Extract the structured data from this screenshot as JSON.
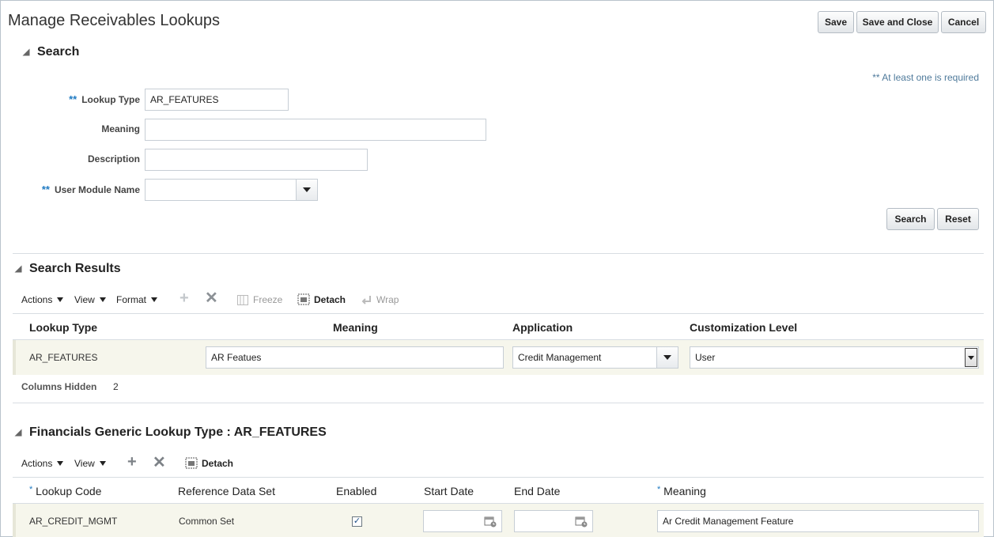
{
  "page": {
    "title": "Manage Receivables Lookups",
    "buttons": {
      "save": "Save",
      "save_and_close": "Save and Close",
      "cancel": "Cancel"
    }
  },
  "search": {
    "header": "Search",
    "required_note": "** At least one is required",
    "required_mark": "**",
    "fields": {
      "lookup_type": {
        "label": "Lookup Type",
        "value": "AR_FEATURES"
      },
      "meaning": {
        "label": "Meaning",
        "value": ""
      },
      "description": {
        "label": "Description",
        "value": ""
      },
      "user_module_name": {
        "label": "User Module Name",
        "value": ""
      }
    },
    "buttons": {
      "search": "Search",
      "reset": "Reset"
    }
  },
  "results": {
    "header": "Search Results",
    "toolbar": {
      "actions": "Actions",
      "view": "View",
      "format": "Format",
      "freeze": "Freeze",
      "detach": "Detach",
      "wrap": "Wrap"
    },
    "columns": [
      "Lookup Type",
      "Meaning",
      "Application",
      "Customization Level"
    ],
    "rows": [
      {
        "lookup_type": "AR_FEATURES",
        "meaning": "AR Featues",
        "application": "Credit Management",
        "customization_level": "User"
      }
    ],
    "columns_hidden_label": "Columns Hidden",
    "columns_hidden_count": "2"
  },
  "detail": {
    "header": "Financials Generic Lookup Type : AR_FEATURES",
    "toolbar": {
      "actions": "Actions",
      "view": "View",
      "detach": "Detach"
    },
    "required_mark": "*",
    "columns": [
      "Lookup Code",
      "Reference Data Set",
      "Enabled",
      "Start Date",
      "End Date",
      "Meaning"
    ],
    "rows": [
      {
        "lookup_code": "AR_CREDIT_MGMT",
        "reference_data_set": "Common Set",
        "enabled": true,
        "start_date": "",
        "end_date": "",
        "meaning": "Ar Credit Management Feature"
      }
    ]
  },
  "icons": {
    "collapse": "collapse-triangle-icon",
    "dropdown": "chevron-down-icon",
    "add": "plus-icon",
    "delete": "x-icon",
    "freeze": "freeze-icon",
    "detach": "detach-icon",
    "wrap": "wrap-icon",
    "calendar": "calendar-icon"
  }
}
